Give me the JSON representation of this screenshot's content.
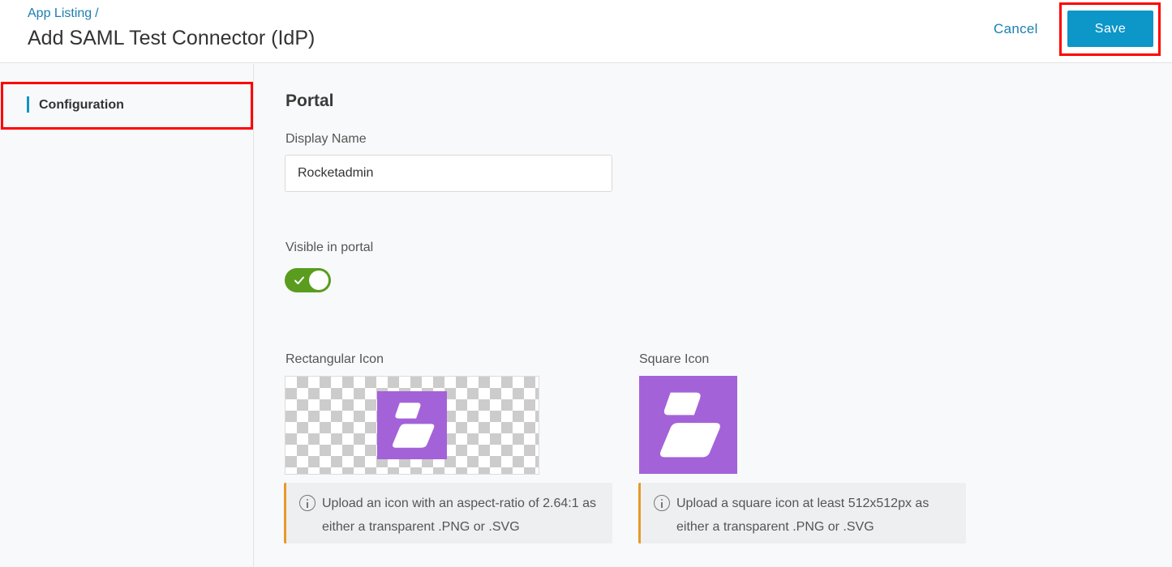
{
  "header": {
    "breadcrumb_link": "App Listing",
    "breadcrumb_sep": "/",
    "title": "Add SAML Test Connector (IdP)",
    "cancel_label": "Cancel",
    "save_label": "Save"
  },
  "sidebar": {
    "items": [
      {
        "label": "Configuration"
      }
    ]
  },
  "main": {
    "section_title": "Portal",
    "display_name": {
      "label": "Display Name",
      "value": "Rocketadmin"
    },
    "visible_in_portal": {
      "label": "Visible in portal",
      "enabled": true
    },
    "rect_icon": {
      "label": "Rectangular Icon",
      "info_line1": "Upload an icon with an aspect-ratio of 2.64:1 as",
      "info_line2": "either a transparent .PNG or .SVG"
    },
    "square_icon": {
      "label": "Square Icon",
      "info_line1": "Upload a square icon at least 512x512px as",
      "info_line2": "either a transparent .PNG or .SVG"
    }
  },
  "colors": {
    "accent": "#0d96c8",
    "link": "#1b7fb0",
    "toggle_on": "#5a9c1e",
    "logo_bg": "#a462d9",
    "info_border": "#e69a2a",
    "highlight": "#ff0000"
  },
  "icons": [
    "check-icon",
    "info-icon",
    "rocketadmin-logo"
  ]
}
